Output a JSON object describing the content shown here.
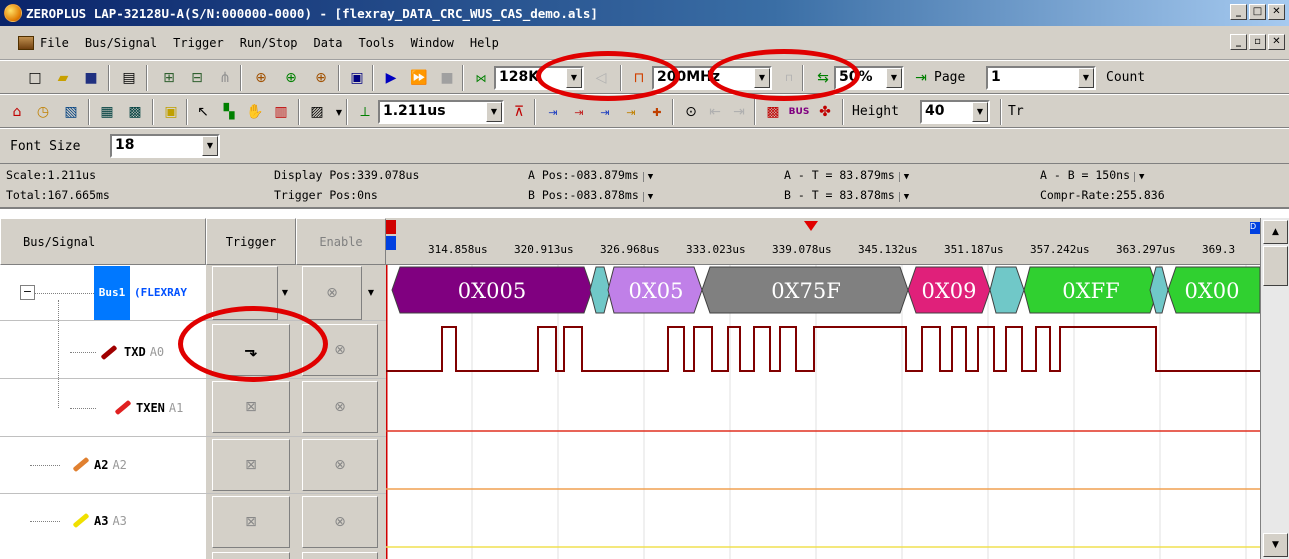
{
  "window": {
    "title": "ZEROPLUS LAP-32128U-A(S/N:000000-0000) - [flexray_DATA_CRC_WUS_CAS_demo.als]",
    "controls": [
      "_",
      "□",
      "✕"
    ]
  },
  "menu": {
    "items": [
      "File",
      "Bus/Signal",
      "Trigger",
      "Run/Stop",
      "Data",
      "Tools",
      "Window",
      "Help"
    ],
    "mdi_controls": [
      "_",
      "▫",
      "✕"
    ]
  },
  "toolbar1": {
    "memory_depth": "128K",
    "sample_rate": "200MHz",
    "zoom": "50%",
    "page_label": "Page",
    "page_value": "1",
    "count_label": "Count"
  },
  "toolbar2": {
    "time_per_div": "1.211us",
    "height_label": "Height",
    "height_value": "40",
    "truncated_label": "Tr"
  },
  "toolbar3": {
    "font_size_label": "Font Size",
    "font_size_value": "18"
  },
  "info": {
    "scale": "Scale:1.211us",
    "total": "Total:167.665ms",
    "display_pos": "Display Pos:339.078us",
    "trigger_pos": "Trigger Pos:0ns",
    "a_pos": "A Pos:-083.879ms",
    "b_pos": "B Pos:-083.878ms",
    "a_minus_t": "A - T = 83.879ms",
    "b_minus_t": "B - T = 83.878ms",
    "a_minus_b": "A - B = 150ns",
    "compr_rate": "Compr-Rate:255.836"
  },
  "columns": {
    "bus_signal": "Bus/Signal",
    "trigger": "Trigger",
    "enable": "Enable"
  },
  "signals": [
    {
      "name": "Bus1",
      "alias": "(FLEXRAY"
    },
    {
      "name": "TXD",
      "alias": "A0"
    },
    {
      "name": "TXEN",
      "alias": "A1"
    },
    {
      "name": "A2",
      "alias": "A2"
    },
    {
      "name": "A3",
      "alias": "A3"
    }
  ],
  "ruler_ticks": [
    "314.858us",
    "320.913us",
    "326.968us",
    "333.023us",
    "339.078us",
    "345.132us",
    "351.187us",
    "357.242us",
    "363.297us",
    "369.3"
  ],
  "bus_decode": [
    "0X005",
    "0X05",
    "0X75F",
    "0X09",
    "0XFF",
    "0X00"
  ],
  "colors": {
    "bus_purple": "#800080",
    "bus_lilac": "#c080e8",
    "bus_gray": "#808080",
    "bus_magenta": "#e0207a",
    "bus_green": "#30d030",
    "bus_teal": "#70c8c8",
    "txd_wave": "#800000",
    "txen_line": "#e03020",
    "a2_line": "#f0a050",
    "a3_line": "#f0e050",
    "annotation": "#e00000"
  }
}
